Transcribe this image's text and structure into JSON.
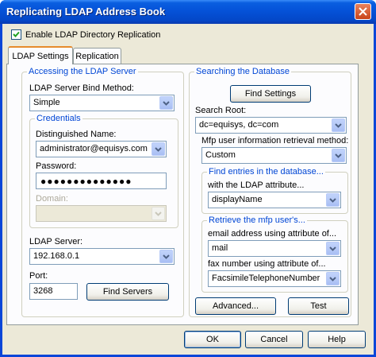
{
  "window": {
    "title": "Replicating LDAP Address Book"
  },
  "enable_replication": {
    "label": "Enable LDAP Directory Replication",
    "checked": true
  },
  "tabs": [
    {
      "label": "LDAP Settings",
      "active": true
    },
    {
      "label": "Replication",
      "active": false
    }
  ],
  "accessing": {
    "group_label": "Accessing the LDAP Server",
    "bind_method_label": "LDAP Server Bind Method:",
    "bind_method_value": "Simple",
    "credentials": {
      "group_label": "Credentials",
      "dn_label": "Distinguished Name:",
      "dn_value": "administrator@equisys.com",
      "password_label": "Password:",
      "password_value": "●●●●●●●●●●●●●●",
      "domain_label": "Domain:",
      "domain_value": ""
    },
    "server_label": "LDAP Server:",
    "server_value": "192.168.0.1",
    "port_label": "Port:",
    "port_value": "3268",
    "find_servers_label": "Find Servers"
  },
  "searching": {
    "group_label": "Searching the Database",
    "find_settings_label": "Find Settings",
    "search_root_label": "Search Root:",
    "search_root_value": "dc=equisys, dc=com",
    "retrieval_method_label": "Mfp user information retrieval method:",
    "retrieval_method_value": "Custom",
    "find_entries": {
      "group_label": "Find entries in the database...",
      "attribute_label": "with the LDAP attribute...",
      "attribute_value": "displayName"
    },
    "retrieve": {
      "group_label": "Retrieve the mfp user's...",
      "email_label": "email address using attribute of...",
      "email_value": "mail",
      "fax_label": "fax number using attribute of...",
      "fax_value": "FacsimileTelephoneNumber"
    },
    "advanced_label": "Advanced...",
    "test_label": "Test"
  },
  "footer": {
    "ok_label": "OK",
    "cancel_label": "Cancel",
    "help_label": "Help"
  },
  "icons": {
    "close": "close-icon",
    "checkmark": "checkmark-icon",
    "dropdown": "chevron-down-icon"
  },
  "colors": {
    "title_blue": "#0a5ee0",
    "group_label_blue": "#0046d5",
    "dialog_bg": "#ece9d8"
  }
}
